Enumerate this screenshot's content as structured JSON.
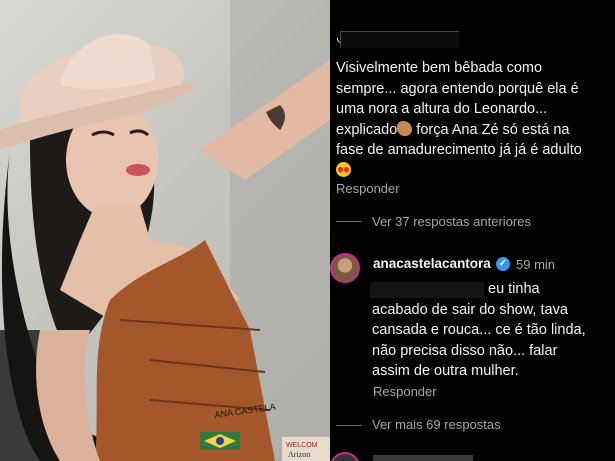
{
  "comment_top": {
    "text_lines": [
      "Visivelmente bem bêbada como",
      "sempre... agora entendo porquê ela é",
      "uma nora a altura do Leonardo...",
      "explicado",
      " força Ana Zé só está na",
      "fase de amadurecimento já já é adulto"
    ],
    "emoji_1": "clapping-hands",
    "emoji_2": "heart-eyes-face",
    "reply_label": "Responder"
  },
  "view_previous": "Ver 37 respostas anteriores",
  "reply": {
    "username": "anacastelacantora",
    "verified": "✓",
    "time": "59 min",
    "text_lines": [
      "eu tinha",
      "acabado de sair do show, tava",
      "cansada e rouca... ce é tão linda,",
      "não precisa disso não... falar",
      "assim de outra mulher."
    ],
    "reply_label": "Responder"
  },
  "view_more": "Ver mais 69 respostas",
  "photo": {
    "jacket_text": "ANA CASTELA",
    "sign_text_1": "WELCOM",
    "sign_text_2": "Arizon"
  },
  "colors": {
    "background": "#000000",
    "text": "#f4f4f4",
    "secondary": "#a8a8a8",
    "verified": "#3897f0",
    "story_ring": "#c32e8c"
  }
}
